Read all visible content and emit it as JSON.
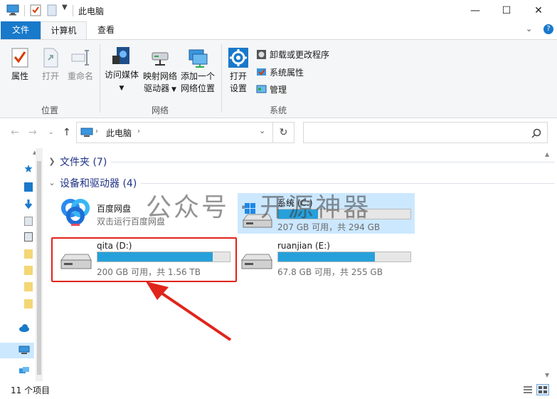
{
  "window": {
    "title": "此电脑",
    "minimize": "—",
    "maximize": "☐",
    "close": "✕"
  },
  "ribbon_tabs": {
    "file": "文件",
    "computer": "计算机",
    "view": "查看",
    "expand": "⌄",
    "help": "?"
  },
  "ribbon": {
    "location": {
      "label": "位置",
      "properties": "属性",
      "open": "打开",
      "rename": "重命名"
    },
    "network": {
      "label": "网络",
      "media_line1": "访问媒体",
      "map_line1": "映射网络",
      "map_line2": "驱动器",
      "add_line1": "添加一个",
      "add_line2": "网络位置"
    },
    "system": {
      "label": "系统",
      "settings_line1": "打开",
      "settings_line2": "设置",
      "uninstall": "卸载或更改程序",
      "sys_props": "系统属性",
      "manage": "管理"
    }
  },
  "address": {
    "path": "此电脑",
    "separator": "›",
    "dropdown": "⌄",
    "refresh": "↻",
    "search_placeholder": ""
  },
  "content": {
    "folders_section": "文件夹 (7)",
    "devices_section": "设备和驱动器 (4)",
    "drives": [
      {
        "name": "百度网盘",
        "info": "双击运行百度网盘"
      },
      {
        "name": "系统 (C:)",
        "info": "207 GB 可用，共 294 GB",
        "used": 0.3
      },
      {
        "name": "qita (D:)",
        "info": "200 GB 可用，共 1.56 TB",
        "used": 0.87
      },
      {
        "name": "ruanjian (E:)",
        "info": "67.8 GB 可用，共 255 GB",
        "used": 0.73
      }
    ]
  },
  "watermark": "公众号 · 开源神器",
  "status": {
    "count": "11 个项目"
  },
  "colors": {
    "accent": "#1979ca",
    "bar_fill": "#26a0da",
    "highlight": "#e0241b",
    "section_title": "#1e3287"
  }
}
